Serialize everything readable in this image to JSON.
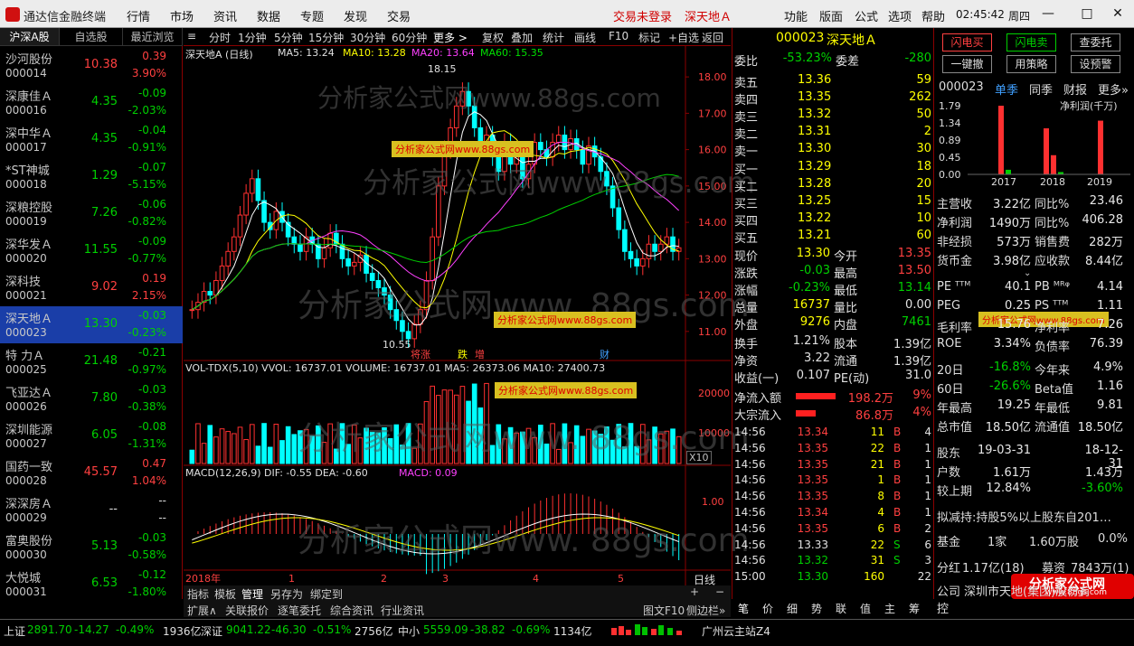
{
  "titlebar": {
    "app_name": "通达信金融终端",
    "menus": [
      "行情",
      "市场",
      "资讯",
      "数据",
      "专题",
      "发现",
      "交易"
    ],
    "trade_status": "交易未登录",
    "stock_title": "深天地Ａ",
    "right_menus": [
      "功能",
      "版面",
      "公式",
      "选项",
      "帮助"
    ],
    "clock": "02:45:42",
    "weekday": "周四"
  },
  "left_list": {
    "tabs": [
      "沪深A股",
      "自选股",
      "最近浏览"
    ],
    "rows": [
      {
        "name": "沙河股份",
        "code": "000014",
        "price": "10.38",
        "change": "0.39",
        "pct": "3.90%",
        "dir": "up"
      },
      {
        "name": "深康佳Ａ",
        "code": "000016",
        "price": "4.35",
        "change": "-0.09",
        "pct": "-2.03%",
        "dir": "dn"
      },
      {
        "name": "深中华Ａ",
        "code": "000017",
        "price": "4.35",
        "change": "-0.04",
        "pct": "-0.91%",
        "dir": "dn"
      },
      {
        "name": "*ST神城",
        "code": "000018",
        "price": "1.29",
        "change": "-0.07",
        "pct": "-5.15%",
        "dir": "dn"
      },
      {
        "name": "深粮控股",
        "code": "000019",
        "price": "7.26",
        "change": "-0.06",
        "pct": "-0.82%",
        "dir": "dn"
      },
      {
        "name": "深华发Ａ",
        "code": "000020",
        "price": "11.55",
        "change": "-0.09",
        "pct": "-0.77%",
        "dir": "dn"
      },
      {
        "name": "深科技",
        "code": "000021",
        "price": "9.02",
        "change": "0.19",
        "pct": "2.15%",
        "dir": "up"
      },
      {
        "name": "深天地Ａ",
        "code": "000023",
        "price": "13.30",
        "change": "-0.03",
        "pct": "-0.23%",
        "dir": "dn"
      },
      {
        "name": "特 力Ａ",
        "code": "000025",
        "price": "21.48",
        "change": "-0.21",
        "pct": "-0.97%",
        "dir": "dn"
      },
      {
        "name": "飞亚达Ａ",
        "code": "000026",
        "price": "7.80",
        "change": "-0.03",
        "pct": "-0.38%",
        "dir": "dn"
      },
      {
        "name": "深圳能源",
        "code": "000027",
        "price": "6.05",
        "change": "-0.08",
        "pct": "-1.31%",
        "dir": "dn"
      },
      {
        "name": "国药一致",
        "code": "000028",
        "price": "45.57",
        "change": "0.47",
        "pct": "1.04%",
        "dir": "up"
      },
      {
        "name": "深深房Ａ",
        "code": "000029",
        "price": "--",
        "change": "--",
        "pct": "--",
        "dir": "wh"
      },
      {
        "name": "富奥股份",
        "code": "000030",
        "price": "5.13",
        "change": "-0.03",
        "pct": "-0.58%",
        "dir": "dn"
      },
      {
        "name": "大悦城",
        "code": "000031",
        "price": "6.53",
        "change": "-0.12",
        "pct": "-1.80%",
        "dir": "dn"
      }
    ]
  },
  "chart_toolbar": {
    "periods": [
      "分时",
      "1分钟",
      "5分钟",
      "15分钟",
      "30分钟",
      "60分钟",
      "更多 >"
    ],
    "tools": [
      "复权",
      "叠加",
      "统计",
      "画线",
      "F10",
      "标记",
      "+自选",
      "返回"
    ]
  },
  "chart": {
    "title": "深天地A (日线)",
    "ma5": "MA5: 13.24",
    "ma10": "MA10: 13.28",
    "ma20": "MA20: 13.64",
    "ma60": "MA60: 15.35",
    "high_label": "18.15",
    "low_label": "10.55",
    "y_ticks": [
      "18.00",
      "17.00",
      "16.00",
      "15.00",
      "14.00",
      "13.00",
      "12.00",
      "11.00"
    ],
    "event_marks": [
      "将涨",
      "跌",
      "增",
      "财"
    ],
    "vol_header": "VOL-TDX(5,10)  VVOL: 16737.01  VOLUME: 16737.01  MA5: 26373.06  MA10: 27400.73",
    "vol_ticks": [
      "20000",
      "10000"
    ],
    "vol_unit": "X10",
    "macd_header": "MACD(12,26,9)  DIF: -0.55  DEA: -0.60",
    "macd_val": "MACD: 0.09",
    "macd_tick": "1.00",
    "x_labels": [
      "2018年",
      "1",
      "2",
      "3",
      "4",
      "5"
    ],
    "period_btn": "日线",
    "watermark_1": "分析家公式网www.88gs.com",
    "watermark_2": "分析家公式网www.88gs.com",
    "watermark_3": "分析家公式网www. 88gs.com",
    "watermark_4": "分析家公式网www. 88gs.com",
    "watermark_5": "分析家公式网www. 88gs.com",
    "tip_label": "分析家公式网www.88gs.com",
    "tip_label_2": "分析家公式网www.88gs.com",
    "tip_label_3": "分析家公式网www.88gs.com"
  },
  "chart_data": {
    "type": "candlestick",
    "title": "深天地A (日线)",
    "ylim": [
      10.3,
      18.5
    ],
    "ma_values": {
      "MA5": 13.24,
      "MA10": 13.28,
      "MA20": 13.64,
      "MA60": 15.35
    },
    "high": 18.15,
    "low": 10.55
  },
  "bottom_tabs": [
    "指标",
    "模板",
    "管理",
    "另存为",
    "绑定到"
  ],
  "bottom_tabs2": [
    "扩展∧",
    "关联报价",
    "逐笔委托",
    "综合资讯",
    "行业资讯"
  ],
  "bottom_right": [
    "图文F10",
    "侧边栏»"
  ],
  "quote": {
    "code": "000023",
    "name": "深天地Ａ",
    "weibi_label": "委比",
    "weibi": "-53.23%",
    "weicha_label": "委差",
    "weicha": "-280",
    "asks": [
      {
        "label": "卖五",
        "price": "13.36",
        "vol": "59"
      },
      {
        "label": "卖四",
        "price": "13.35",
        "vol": "262"
      },
      {
        "label": "卖三",
        "price": "13.32",
        "vol": "50"
      },
      {
        "label": "卖二",
        "price": "13.31",
        "vol": "2"
      },
      {
        "label": "卖一",
        "price": "13.30",
        "vol": "30"
      }
    ],
    "bids": [
      {
        "label": "买一",
        "price": "13.29",
        "vol": "18"
      },
      {
        "label": "买二",
        "price": "13.28",
        "vol": "20"
      },
      {
        "label": "买三",
        "price": "13.25",
        "vol": "15"
      },
      {
        "label": "买四",
        "price": "13.22",
        "vol": "10"
      },
      {
        "label": "买五",
        "price": "13.21",
        "vol": "60"
      }
    ],
    "stats": [
      {
        "l1": "现价",
        "v1": "13.30",
        "l2": "今开",
        "v2": "13.35"
      },
      {
        "l1": "涨跌",
        "v1": "-0.03",
        "l2": "最高",
        "v2": "13.50"
      },
      {
        "l1": "涨幅",
        "v1": "-0.23%",
        "l2": "最低",
        "v2": "13.14"
      },
      {
        "l1": "总量",
        "v1": "16737",
        "l2": "量比",
        "v2": "0.00"
      },
      {
        "l1": "外盘",
        "v1": "9276",
        "l2": "内盘",
        "v2": "7461"
      }
    ],
    "stats2": [
      {
        "l1": "换手",
        "v1": "1.21%",
        "l2": "股本",
        "v2": "1.39亿"
      },
      {
        "l1": "净资",
        "v1": "3.22",
        "l2": "流通",
        "v2": "1.39亿"
      },
      {
        "l1": "收益(一)",
        "v1": "0.107",
        "l2": "PE(动)",
        "v2": "31.0"
      }
    ],
    "flow_in_label": "净流入额",
    "flow_in": "198.2万",
    "flow_in_pct": "9%",
    "big_in_label": "大宗流入",
    "big_in": "86.8万",
    "big_in_pct": "4%",
    "ticks": [
      {
        "t": "14:56",
        "p": "13.34",
        "v": "11",
        "bs": "B",
        "n": "4"
      },
      {
        "t": "14:56",
        "p": "13.35",
        "v": "22",
        "bs": "B",
        "n": "1"
      },
      {
        "t": "14:56",
        "p": "13.35",
        "v": "21",
        "bs": "B",
        "n": "1"
      },
      {
        "t": "14:56",
        "p": "13.35",
        "v": "1",
        "bs": "B",
        "n": "1"
      },
      {
        "t": "14:56",
        "p": "13.35",
        "v": "8",
        "bs": "B",
        "n": "1"
      },
      {
        "t": "14:56",
        "p": "13.34",
        "v": "4",
        "bs": "B",
        "n": "1"
      },
      {
        "t": "14:56",
        "p": "13.35",
        "v": "6",
        "bs": "B",
        "n": "2"
      },
      {
        "t": "14:56",
        "p": "13.33",
        "v": "22",
        "bs": "S",
        "n": "6"
      },
      {
        "t": "14:56",
        "p": "13.32",
        "v": "31",
        "bs": "S",
        "n": "3"
      },
      {
        "t": "15:00",
        "p": "13.30",
        "v": "160",
        "bs": "",
        "n": "22"
      }
    ],
    "bottom_tabs": [
      "笔",
      "价",
      "细",
      "势",
      "联",
      "值",
      "主",
      "筹"
    ]
  },
  "far": {
    "buttons": [
      "闪电买",
      "闪电卖",
      "查委托",
      "一键撤",
      "用策略",
      "设预警"
    ],
    "fin_code": "000023",
    "fin_tabs": [
      "单季",
      "同季",
      "财报",
      "更多»"
    ],
    "fin_values": [
      "1.79",
      "1.34",
      "0.89",
      "0.45",
      "0.00"
    ],
    "fin_title": "净利润(千万)",
    "fin_years": [
      "2017",
      "2018",
      "2019"
    ],
    "fin_rows": [
      {
        "l1": "主营收",
        "v1": "3.22亿",
        "l2": "同比%",
        "v2": "23.46"
      },
      {
        "l1": "净利润",
        "v1": "1490万",
        "l2": "同比%",
        "v2": "406.28"
      },
      {
        "l1": "非经损",
        "v1": "573万",
        "l2": "销售费",
        "v2": "282万"
      },
      {
        "l1": "货币金",
        "v1": "3.98亿",
        "l2": "应收款",
        "v2": "8.44亿"
      }
    ],
    "val_rows": [
      {
        "l1": "PE ᵀᵀᴹ",
        "v1": "40.1",
        "l2": "PB ᴹᴿᵠ",
        "v2": "4.14"
      },
      {
        "l1": "PEG",
        "v1": "0.25",
        "l2": "PS ᵀᵀᴹ",
        "v2": "1.11"
      },
      {
        "l1": "毛利率",
        "v1": "15.76",
        "l2": "净利率",
        "v2": "7.26"
      },
      {
        "l1": "ROE",
        "v1": "3.34%",
        "l2": "负债率",
        "v2": "76.39"
      }
    ],
    "perf_rows": [
      {
        "l1": "20日",
        "v1": "-16.8%",
        "l2": "今年来",
        "v2": "4.9%"
      },
      {
        "l1": "60日",
        "v1": "-26.6%",
        "l2": "Beta值",
        "v2": "1.16"
      },
      {
        "l1": "年最高",
        "v1": "19.25",
        "l2": "年最低",
        "v2": "9.81"
      },
      {
        "l1": "总市值",
        "v1": "18.50亿",
        "l2": "流通值",
        "v2": "18.50亿"
      }
    ],
    "holder_rows": [
      {
        "l1": "股东",
        "v1": "19-03-31",
        "l2": "",
        "v2": "18-12-31"
      },
      {
        "l1": "户数",
        "v1": "1.61万",
        "l2": "",
        "v2": "1.43万"
      },
      {
        "l1": "较上期",
        "v1": "12.84%",
        "l2": "",
        "v2": "-3.60%"
      }
    ],
    "news": "拟减持:持股5%以上股东自201…",
    "fund_label": "基金",
    "fund_v1": "1家",
    "fund_v2": "1.60万股",
    "fund_v3": "0.0%",
    "div_label": "分红",
    "div_v1": "1.17亿(18)",
    "div_l2": "募资",
    "div_v2": "7843万(1)",
    "company_label": "公司",
    "company": "深圳市天地(集团)股份有",
    "ctrl_label": "控",
    "tip": "分析家公式网www.88gs.com",
    "logo_text": "分析家公式网",
    "logo_url": "www.88gs.com"
  },
  "status": {
    "sh_label": "上证",
    "sh": "2891.70",
    "sh_ch": "-14.27",
    "sh_pct": "-0.49%",
    "sh_amt": "1936亿",
    "sz_label": "深证",
    "sz": "9041.22",
    "sz_ch": "-46.30",
    "sz_pct": "-0.51%",
    "sz_amt": "2756亿",
    "zx_label": "中小",
    "zx": "5559.09",
    "zx_ch": "-38.82",
    "zx_pct": "-0.69%",
    "zx_amt": "1134亿",
    "server": "广州云主站Z4"
  }
}
